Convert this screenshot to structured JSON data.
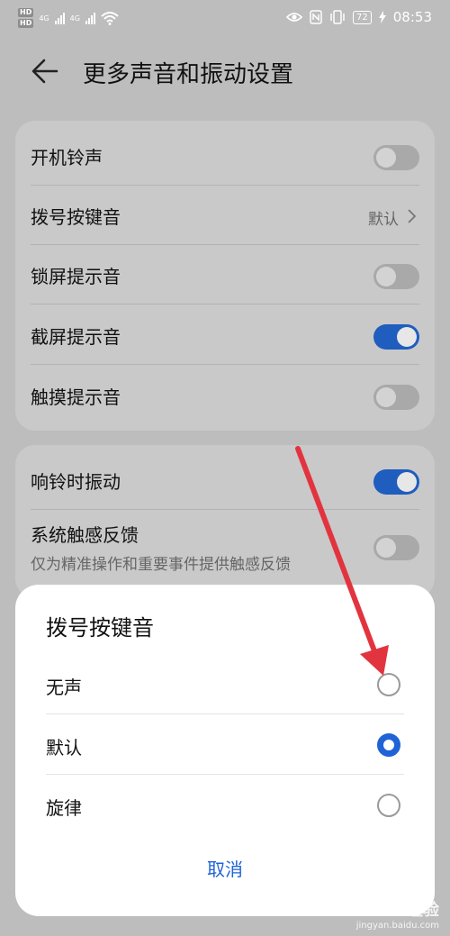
{
  "status_bar": {
    "hd1": "HD",
    "hd2": "HD",
    "net1": "4G",
    "net2": "4G",
    "battery": "72",
    "time": "08:53",
    "icons": [
      "eye-icon",
      "nfc-icon",
      "vibrate-icon",
      "battery-icon",
      "charging-icon",
      "wifi-icon",
      "signal-icon"
    ]
  },
  "header": {
    "title": "更多声音和振动设置",
    "back_icon": "back-arrow-icon"
  },
  "settings_group1": {
    "items": [
      {
        "label": "开机铃声",
        "type": "toggle",
        "on": false
      },
      {
        "label": "拨号按键音",
        "type": "value",
        "value": "默认"
      },
      {
        "label": "锁屏提示音",
        "type": "toggle",
        "on": false
      },
      {
        "label": "截屏提示音",
        "type": "toggle",
        "on": true
      },
      {
        "label": "触摸提示音",
        "type": "toggle",
        "on": false
      }
    ]
  },
  "settings_group2": {
    "items": [
      {
        "label": "响铃时振动",
        "type": "toggle",
        "on": true
      },
      {
        "label": "系统触感反馈",
        "sublabel": "仅为精准操作和重要事件提供触感反馈",
        "type": "toggle",
        "on": false
      }
    ]
  },
  "dialog": {
    "title": "拨号按键音",
    "options": [
      {
        "label": "无声",
        "selected": false
      },
      {
        "label": "默认",
        "selected": true
      },
      {
        "label": "旋律",
        "selected": false
      }
    ],
    "cancel_label": "取消"
  },
  "watermark": {
    "line1": "Bai 经验",
    "line2": "jingyan.baidu.com"
  },
  "colors": {
    "accent": "#1f63d6",
    "annotation_arrow": "#e2343f"
  }
}
